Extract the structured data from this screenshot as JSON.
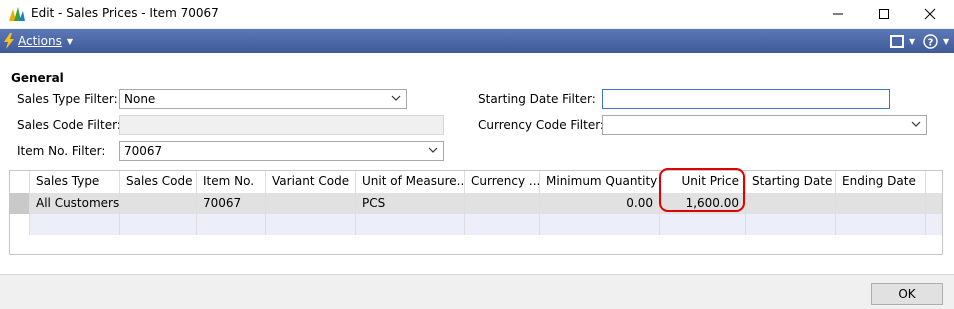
{
  "window": {
    "title": "Edit - Sales Prices - Item 70067"
  },
  "actionbar": {
    "actions_label": "Actions"
  },
  "general": {
    "section_title": "General",
    "sales_type_filter": {
      "label": "Sales Type Filter:",
      "value": "None"
    },
    "sales_code_filter": {
      "label": "Sales Code Filter:",
      "value": ""
    },
    "item_no_filter": {
      "label": "Item No. Filter:",
      "value": "70067"
    },
    "starting_date_filter": {
      "label": "Starting Date Filter:",
      "value": ""
    },
    "currency_code_filter": {
      "label": "Currency Code Filter:",
      "value": ""
    }
  },
  "grid": {
    "columns": [
      "Sales Type",
      "Sales Code",
      "Item No.",
      "Variant Code",
      "Unit of Measure...",
      "Currency ...",
      "Minimum Quantity",
      "Unit Price",
      "Starting Date",
      "Ending Date"
    ],
    "rows": [
      [
        "All Customers",
        "",
        "70067",
        "",
        "PCS",
        "",
        "0.00",
        "1,600.00",
        "",
        ""
      ]
    ]
  },
  "footer": {
    "ok_label": "OK"
  },
  "colors": {
    "actionbar": "#4a66a8",
    "highlight": "#e00000",
    "selected_row": "#e1e1e1",
    "new_row": "#eceef9"
  },
  "icons": [
    "dynamics-nav-logo-icon",
    "minimize-icon",
    "maximize-icon",
    "close-icon",
    "lightning-icon",
    "layout-icon",
    "help-icon",
    "chevron-down-icon"
  ]
}
